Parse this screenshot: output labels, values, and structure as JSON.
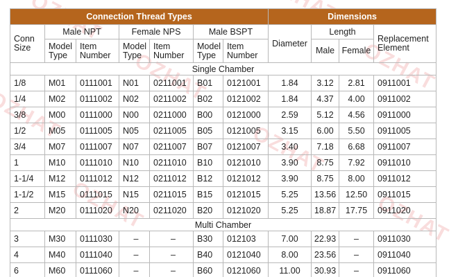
{
  "header": {
    "thread_types": "Connection Thread Types",
    "dimensions": "Dimensions"
  },
  "groups": {
    "male_npt": "Male NPT",
    "female_nps": "Female NPS",
    "male_bspt": "Male BSPT",
    "diameter": "Diameter",
    "length": "Length",
    "replacement_1": "Replacement",
    "replacement_2": "Element"
  },
  "subheaders": {
    "conn_1": "Conn",
    "conn_2": "Size",
    "model_1": "Model",
    "model_2": "Type",
    "item_1": "Item",
    "item_2": "Number",
    "male": "Male",
    "female": "Female"
  },
  "sections": {
    "single": "Single Chamber",
    "multi": "Multi Chamber"
  },
  "single_rows": [
    [
      "1/8",
      "M01",
      "0111001",
      "N01",
      "0211001",
      "B01",
      "0121001",
      "1.84",
      "3.12",
      "2.81",
      "0911001"
    ],
    [
      "1/4",
      "M02",
      "0111002",
      "N02",
      "0211002",
      "B02",
      "0121002",
      "1.84",
      "4.37",
      "4.00",
      "0911002"
    ],
    [
      "3/8",
      "M00",
      "0111000",
      "N00",
      "0211000",
      "B00",
      "0121000",
      "2.59",
      "5.12",
      "4.56",
      "0911000"
    ],
    [
      "1/2",
      "M05",
      "0111005",
      "N05",
      "0211005",
      "B05",
      "0121005",
      "3.15",
      "6.00",
      "5.50",
      "0911005"
    ],
    [
      "3/4",
      "M07",
      "0111007",
      "N07",
      "0211007",
      "B07",
      "0121007",
      "3.40",
      "7.18",
      "6.68",
      "0911007"
    ],
    [
      "1",
      "M10",
      "0111010",
      "N10",
      "0211010",
      "B10",
      "0121010",
      "3.90",
      "8.75",
      "7.92",
      "0911010"
    ],
    [
      "1-1/4",
      "M12",
      "0111012",
      "N12",
      "0211012",
      "B12",
      "0121012",
      "3.90",
      "8.75",
      "8.00",
      "0911012"
    ],
    [
      "1-1/2",
      "M15",
      "0111015",
      "N15",
      "0211015",
      "B15",
      "0121015",
      "5.25",
      "13.56",
      "12.50",
      "0911015"
    ],
    [
      "2",
      "M20",
      "0111020",
      "N20",
      "0211020",
      "B20",
      "0121020",
      "5.25",
      "18.87",
      "17.75",
      "0911020"
    ]
  ],
  "multi_rows": [
    [
      "3",
      "M30",
      "0111030",
      "–",
      "–",
      "B30",
      "012103",
      "7.00",
      "22.93",
      "–",
      "0911030"
    ],
    [
      "4",
      "M40",
      "0111040",
      "–",
      "–",
      "B40",
      "0121040",
      "8.00",
      "23.56",
      "–",
      "0911040"
    ],
    [
      "6",
      "M60",
      "0111060",
      "–",
      "–",
      "B60",
      "0121060",
      "11.00",
      "30.93",
      "–",
      "0911060"
    ]
  ],
  "watermark": "OZHAT",
  "colors": {
    "header_bg": "#b5651d",
    "header_text": "#ffffff",
    "grid": "#b8b8b8",
    "watermark": "#e05454"
  }
}
